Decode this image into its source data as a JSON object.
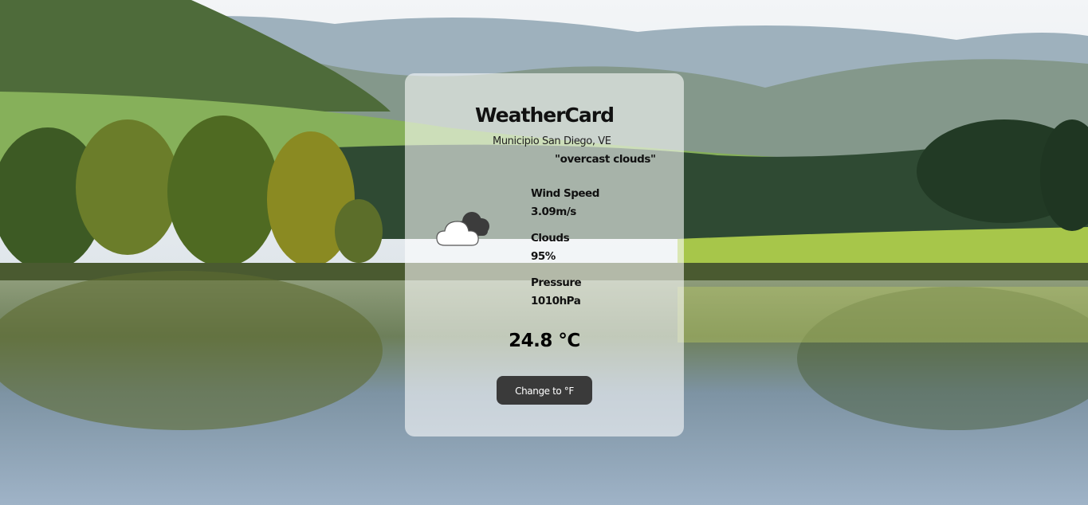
{
  "card": {
    "title": "WeatherCard",
    "location": "Municipio San Diego, VE",
    "description": "\"overcast clouds\"",
    "icon": "cloud-icon",
    "stats": [
      {
        "label": "Wind Speed",
        "value": "3.09m/s"
      },
      {
        "label": "Clouds",
        "value": "95%"
      },
      {
        "label": "Pressure",
        "value": "1010hPa"
      }
    ],
    "temperature": "24.8 °C",
    "unit_button_label": "Change to °F"
  },
  "colors": {
    "card_background": "#ffffff",
    "button_background": "#3a3a3a",
    "button_text": "#ffffff"
  }
}
